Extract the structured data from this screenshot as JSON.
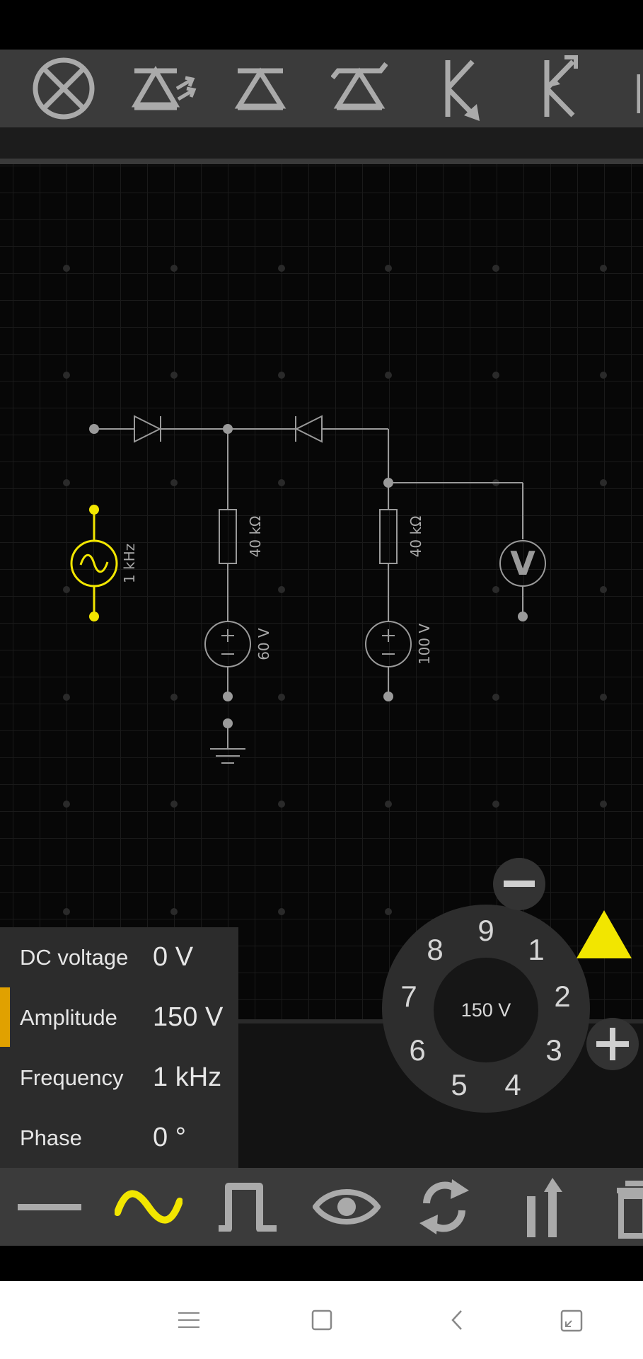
{
  "top_toolbar": {
    "items": [
      "lamp-icon",
      "led-icon",
      "diode-icon",
      "zener-diode-icon",
      "npn-transistor-icon",
      "pnp-transistor-icon",
      "more-icon"
    ]
  },
  "circuit": {
    "source_frequency": "1 kHz",
    "resistor1_value": "40 kΩ",
    "resistor2_value": "40 kΩ",
    "battery1_value": "60 V",
    "battery2_value": "100 V",
    "voltmeter_symbol": "V",
    "highlight_color": "#f2e600",
    "wire_color": "#9a9a9a"
  },
  "properties": {
    "rows": [
      {
        "label": "DC voltage",
        "value": "0 V"
      },
      {
        "label": "Amplitude",
        "value": "150 V"
      },
      {
        "label": "Frequency",
        "value": "1 kHz"
      },
      {
        "label": "Phase",
        "value": "0 °"
      }
    ],
    "selected_row": "Amplitude",
    "selected_color": "#e0a100"
  },
  "dial": {
    "center_value": "150 V",
    "numbers": [
      "1",
      "2",
      "3",
      "4",
      "5",
      "6",
      "7",
      "8",
      "9"
    ]
  },
  "bottom_toolbar": {
    "items": [
      "dc-line-icon",
      "sine-wave-icon",
      "square-wave-icon",
      "eye-icon",
      "rotate-icon",
      "flip-icon",
      "trash-icon"
    ],
    "active_item": "sine-wave-icon",
    "active_color": "#f2e600"
  },
  "nav_bar": {
    "items": [
      "menu-icon",
      "home-icon",
      "back-icon",
      "fullscreen-icon"
    ]
  }
}
